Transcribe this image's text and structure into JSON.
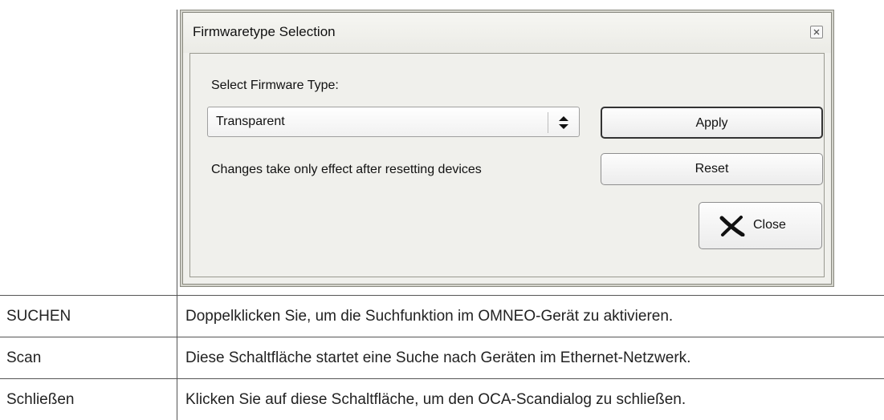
{
  "dialog": {
    "title": "Firmwaretype Selection",
    "select_label": "Select Firmware Type:",
    "firmware_select": {
      "value": "Transparent"
    },
    "apply_label": "Apply",
    "note": "Changes take only effect after resetting devices",
    "reset_label": "Reset",
    "close_label": "Close"
  },
  "table": {
    "rows": [
      {
        "term": "SUCHEN",
        "desc": "Doppelklicken Sie, um die Suchfunktion im OMNEO-Gerät zu aktivieren."
      },
      {
        "term": "Scan",
        "desc": "Diese Schaltfläche startet eine Suche nach Geräten im Ethernet-Netzwerk."
      },
      {
        "term": "Schließen",
        "desc": "Klicken Sie auf diese Schaltfläche, um den OCA-Scandialog zu schließen."
      }
    ]
  }
}
